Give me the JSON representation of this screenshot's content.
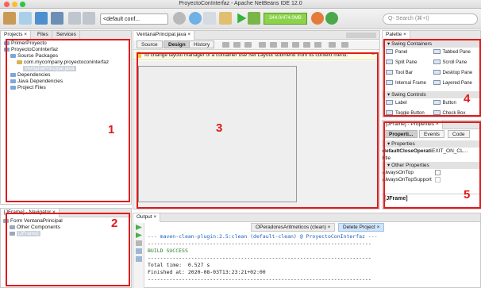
{
  "window": {
    "title": "ProyectoConInterfaz - Apache NetBeans IDE 12.0"
  },
  "toolbar": {
    "config_value": "<default conf...",
    "memory": "344.0/474.0MB",
    "search_placeholder": "Q- Search (⌘+I)"
  },
  "projects": {
    "tabs": [
      "Projects ×",
      "Files",
      "Services"
    ],
    "tree": [
      {
        "label": "PrimerProyecto",
        "indent": 0
      },
      {
        "label": "ProyectoConInterfaz",
        "indent": 0
      },
      {
        "label": "Source Packages",
        "indent": 1
      },
      {
        "label": "com.mycompany.proyectoconinterfaz",
        "indent": 2
      },
      {
        "label": "VentanaPrincipal.java",
        "indent": 3
      },
      {
        "label": "Dependencies",
        "indent": 1
      },
      {
        "label": "Java Dependencies",
        "indent": 1
      },
      {
        "label": "Project Files",
        "indent": 1
      }
    ]
  },
  "navigator": {
    "title": "[JFrame] - Navigator ×",
    "items": [
      "Form VentanaPrincipal",
      "Other Components",
      "[JFrame]"
    ]
  },
  "editor": {
    "tab": "VentanaPrincipal.java ×",
    "modes": [
      "Source",
      "Design",
      "History"
    ],
    "hint": "To change layout manager of a container use Set Layout submenu from its context menu."
  },
  "palette": {
    "title": "Palette ×",
    "sections": [
      {
        "label": "Swing Containers",
        "items": [
          "Panel",
          "Tabbed Pane",
          "Split Pane",
          "Scroll Pane",
          "Tool Bar",
          "Desktop Pane",
          "Internal Frame",
          "Layered Pane"
        ]
      },
      {
        "label": "Swing Controls",
        "items": [
          "Label",
          "Button",
          "Toggle Button",
          "Check Box"
        ]
      }
    ]
  },
  "properties": {
    "title": "[JFrame] - Properties ×",
    "tabs": [
      "Properti...",
      "Events",
      "Code"
    ],
    "section1": "Properties",
    "rows1": [
      {
        "name": "defaultCloseOperati",
        "value": "EXIT_ON_CL..."
      },
      {
        "name": "title",
        "value": ""
      }
    ],
    "section2": "Other Properties",
    "rows2": [
      {
        "name": "alwaysOnTop",
        "value": ""
      },
      {
        "name": "alwaysOnTopSupport",
        "value": ""
      }
    ],
    "footer": "[JFrame]"
  },
  "output": {
    "title": "Output ×",
    "tabs": [
      "OPeradoresAritmeticos (clean) ×",
      "Delete Project ×"
    ],
    "lines": [
      "--- maven-clean-plugin:2.5:clean (default-clean) @ ProyectoConInterfaz ---",
      "------------------------------------------------------------------------",
      "BUILD SUCCESS",
      "------------------------------------------------------------------------",
      "Total time:  0.527 s",
      "Finished at: 2020-08-03T13:23:21+02:00",
      "------------------------------------------------------------------------"
    ]
  },
  "annotations": [
    "1",
    "2",
    "3",
    "4",
    "5"
  ],
  "colors": {
    "annotation": "#e21a1a",
    "memory": "#8bd34a",
    "link": "#1f5fb8"
  }
}
